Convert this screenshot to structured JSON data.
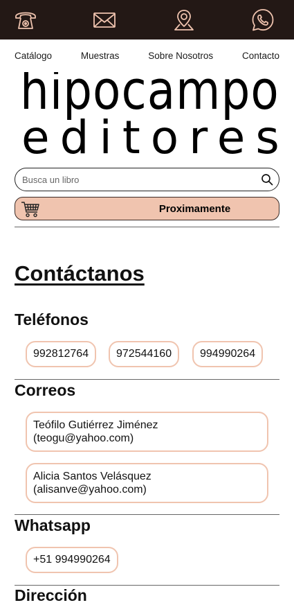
{
  "topbar": {
    "icons": [
      "telephone-icon",
      "mail-icon",
      "map-pin-icon",
      "whatsapp-icon"
    ],
    "background": "#231815",
    "icon_color": "#f0c4af"
  },
  "nav": {
    "items": [
      "Catálogo",
      "Muestras",
      "Sobre Nosotros",
      "Contacto"
    ]
  },
  "logo": {
    "line1": "hipocampo",
    "line2": "editores"
  },
  "search": {
    "placeholder": "Busca un libro"
  },
  "cart": {
    "label": "Proximamente",
    "color": "#f0c4af"
  },
  "page": {
    "title": "Contáctanos"
  },
  "phones": {
    "heading": "Teléfonos",
    "numbers": [
      "992812764",
      "972544160",
      "994990264"
    ]
  },
  "emails": {
    "heading": "Correos",
    "entries": [
      {
        "name": "Teófilo Gutiérrez Jiménez",
        "email": "(teogu@yahoo.com)"
      },
      {
        "name": "Alicia Santos Velásquez",
        "email": "(alisanve@yahoo.com)"
      }
    ]
  },
  "whatsapp": {
    "heading": "Whatsapp",
    "number": "+51 994990264"
  },
  "address": {
    "heading": "Dirección"
  }
}
